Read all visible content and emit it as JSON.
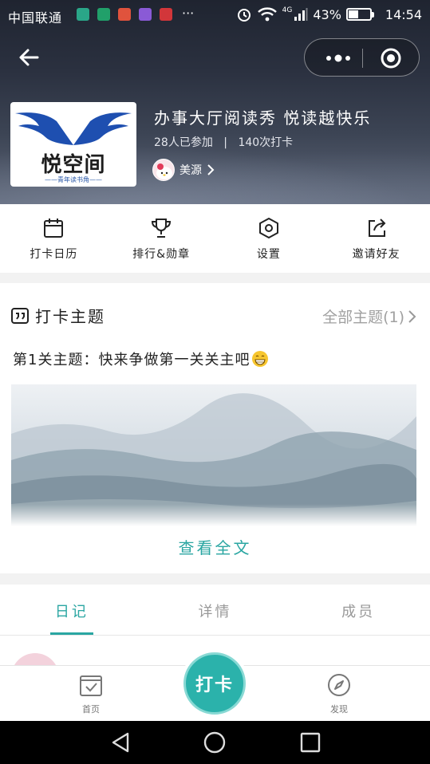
{
  "status_bar": {
    "carrier": "中国联通",
    "more": "···",
    "network": "4G",
    "battery": "43%",
    "time": "14:54"
  },
  "header": {
    "logo_text": "悦空间",
    "logo_sub": "——青年读书角——",
    "title": "办事大厅阅读秀 悦读越快乐",
    "participants": "28人已参加",
    "separator": "|",
    "checkins": "140次打卡",
    "owner_name": "美源"
  },
  "actions": [
    {
      "label": "打卡日历",
      "icon": "calendar-icon"
    },
    {
      "label": "排行&勋章",
      "icon": "trophy-icon"
    },
    {
      "label": "设置",
      "icon": "settings-icon"
    },
    {
      "label": "邀请好友",
      "icon": "share-icon"
    }
  ],
  "topic": {
    "heading": "打卡主题",
    "all_link": "全部主题(1)",
    "line": "第1关主题：快来争做第一关关主吧",
    "read_more": "查看全文"
  },
  "tabs": [
    {
      "label": "日记",
      "active": true
    },
    {
      "label": "详情",
      "active": false
    },
    {
      "label": "成员",
      "active": false
    }
  ],
  "bottom_nav": {
    "home": "首页",
    "checkin": "打卡",
    "discover": "发现"
  },
  "colors": {
    "accent": "#2aa6a2",
    "accent_button": "#2bb2ab"
  }
}
